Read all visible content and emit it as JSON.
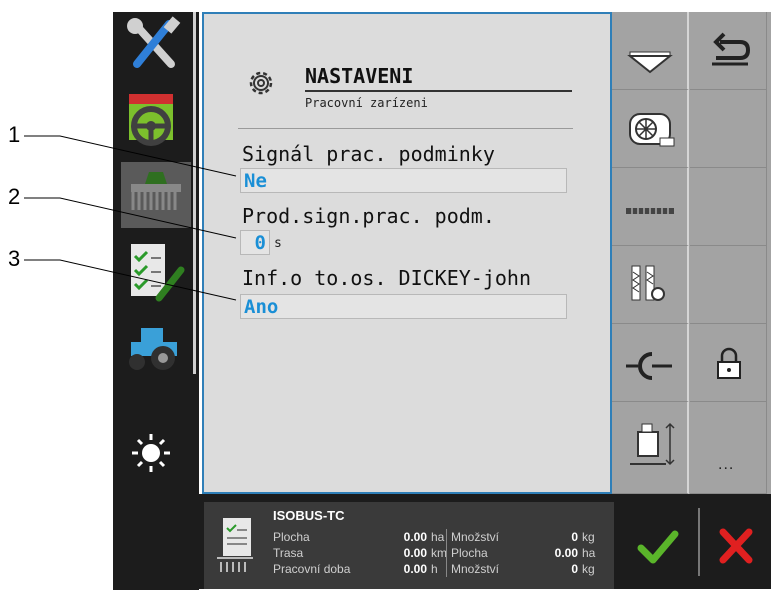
{
  "callouts": [
    "1",
    "2",
    "3"
  ],
  "header": {
    "title": "NASTAVENI",
    "subtitle": "Pracovní zarízeni"
  },
  "settings": [
    {
      "label": "Signál prac. podminky",
      "value": "Ne",
      "unit": ""
    },
    {
      "label": "Prod.sign.prac. podm.",
      "value": "0",
      "unit": "s"
    },
    {
      "label": "Inf.o to.os. DICKEY-john",
      "value": "Ano",
      "unit": ""
    }
  ],
  "sidebar": {
    "items": [
      "tools-icon",
      "steering-wheel-icon",
      "seeder-icon",
      "checklist-icon",
      "tractor-icon",
      "brightness-icon",
      "switch-window-icon"
    ]
  },
  "softkeys": {
    "items": [
      "funnel-icon",
      "back-arrow-icon",
      "fan-icon",
      "",
      "seed-row-icon",
      "",
      "sensor-settings-icon",
      "",
      "coupling-icon",
      "lock-icon",
      "lift-icon",
      "more-icon"
    ],
    "more_label": "..."
  },
  "status": {
    "title": "ISOBUS-TC",
    "rows": [
      {
        "label1": "Plocha",
        "val1": "0.00",
        "unit1": "ha",
        "label2": "Množství",
        "val2": "0",
        "unit2": "kg"
      },
      {
        "label1": "Trasa",
        "val1": "0.00",
        "unit1": "km",
        "label2": "Plocha",
        "val2": "0.00",
        "unit2": "ha"
      },
      {
        "label1": "Pracovní doba",
        "val1": "0.00",
        "unit1": "h",
        "label2": "Množství",
        "val2": "0",
        "unit2": "kg"
      }
    ]
  },
  "colors": {
    "accent": "#1a8fd6",
    "panel": "#dcdcdc",
    "softkey": "#a3a3a3",
    "confirm": "#5ab52a",
    "cancel": "#e02020"
  }
}
